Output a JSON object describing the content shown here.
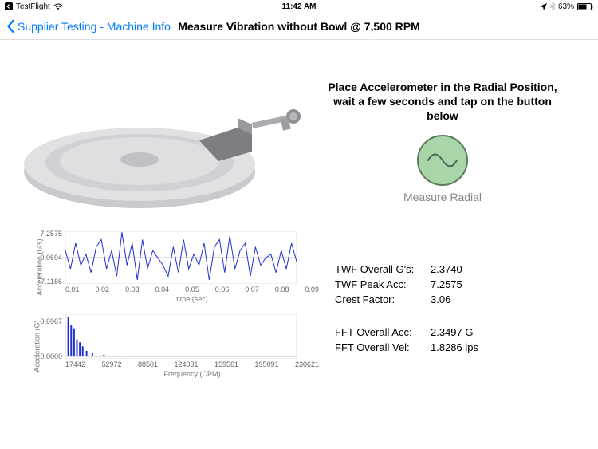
{
  "status": {
    "carrier": "TestFlight",
    "time": "11:42 AM",
    "battery": "63%"
  },
  "nav": {
    "back_label": "Supplier Testing - Machine Info",
    "title": "Measure Vibration without Bowl @ 7,500 RPM"
  },
  "instruction": "Place Accelerometer in the Radial Position, wait a few seconds and tap on the button below",
  "measure_button_label": "Measure Radial",
  "readings": {
    "twf_overall_g_label": "TWF Overall G's:",
    "twf_overall_g_value": "2.3740",
    "twf_peak_acc_label": "TWF Peak Acc:",
    "twf_peak_acc_value": "7.2575",
    "crest_factor_label": "Crest Factor:",
    "crest_factor_value": "3.06",
    "fft_overall_acc_label": "FFT Overall Acc:",
    "fft_overall_acc_value": "2.3497 G",
    "fft_overall_vel_label": "FFT Overall Vel:",
    "fft_overall_vel_value": "1.8286 ips"
  },
  "chart_data": [
    {
      "type": "line",
      "title": "",
      "xlabel": "time (sec)",
      "ylabel": "Acceleration (G's)",
      "xlim": [
        0,
        0.09
      ],
      "ylim": [
        -7.12,
        7.26
      ],
      "yticks": [
        "7.2575",
        "0.0694",
        "-7.1186"
      ],
      "xticks": [
        "0.01",
        "0.02",
        "0.03",
        "0.04",
        "0.05",
        "0.06",
        "0.07",
        "0.08",
        "0.09"
      ],
      "x": [
        0,
        0.002,
        0.004,
        0.006,
        0.008,
        0.01,
        0.012,
        0.014,
        0.016,
        0.018,
        0.02,
        0.022,
        0.024,
        0.026,
        0.028,
        0.03,
        0.032,
        0.034,
        0.036,
        0.038,
        0.04,
        0.042,
        0.044,
        0.046,
        0.048,
        0.05,
        0.052,
        0.054,
        0.056,
        0.058,
        0.06,
        0.062,
        0.064,
        0.066,
        0.068,
        0.07,
        0.072,
        0.074,
        0.076,
        0.078,
        0.08,
        0.082,
        0.084,
        0.086,
        0.088,
        0.09
      ],
      "values": [
        2,
        -3,
        4,
        -2,
        1,
        -4,
        3,
        5,
        -3,
        2,
        -5,
        7,
        -2,
        4,
        -6,
        5,
        -3,
        2,
        0,
        -2,
        -5,
        3,
        -4,
        5,
        -3,
        1,
        -2,
        4,
        -6,
        3,
        5,
        -4,
        6,
        -3,
        2,
        4,
        -5,
        3,
        -2,
        0,
        1,
        -4,
        2,
        -3,
        4,
        -1
      ]
    },
    {
      "type": "line",
      "title": "",
      "xlabel": "Frequency (CPM)",
      "ylabel": "Acceleration (G)",
      "xlim": [
        0,
        240000
      ],
      "ylim": [
        0,
        0.75
      ],
      "yticks": [
        "0.6967",
        "0.0000"
      ],
      "xticks": [
        "17442",
        "52972",
        "88501",
        "124031",
        "159561",
        "195091",
        "230621"
      ],
      "x": [
        3000,
        6000,
        9000,
        12000,
        15000,
        18000,
        22000,
        28000,
        40000,
        60000,
        90000,
        130000,
        180000,
        230000
      ],
      "values": [
        0.7,
        0.55,
        0.5,
        0.3,
        0.25,
        0.18,
        0.1,
        0.06,
        0.03,
        0.015,
        0.008,
        0.004,
        0.002,
        0.001
      ]
    }
  ]
}
